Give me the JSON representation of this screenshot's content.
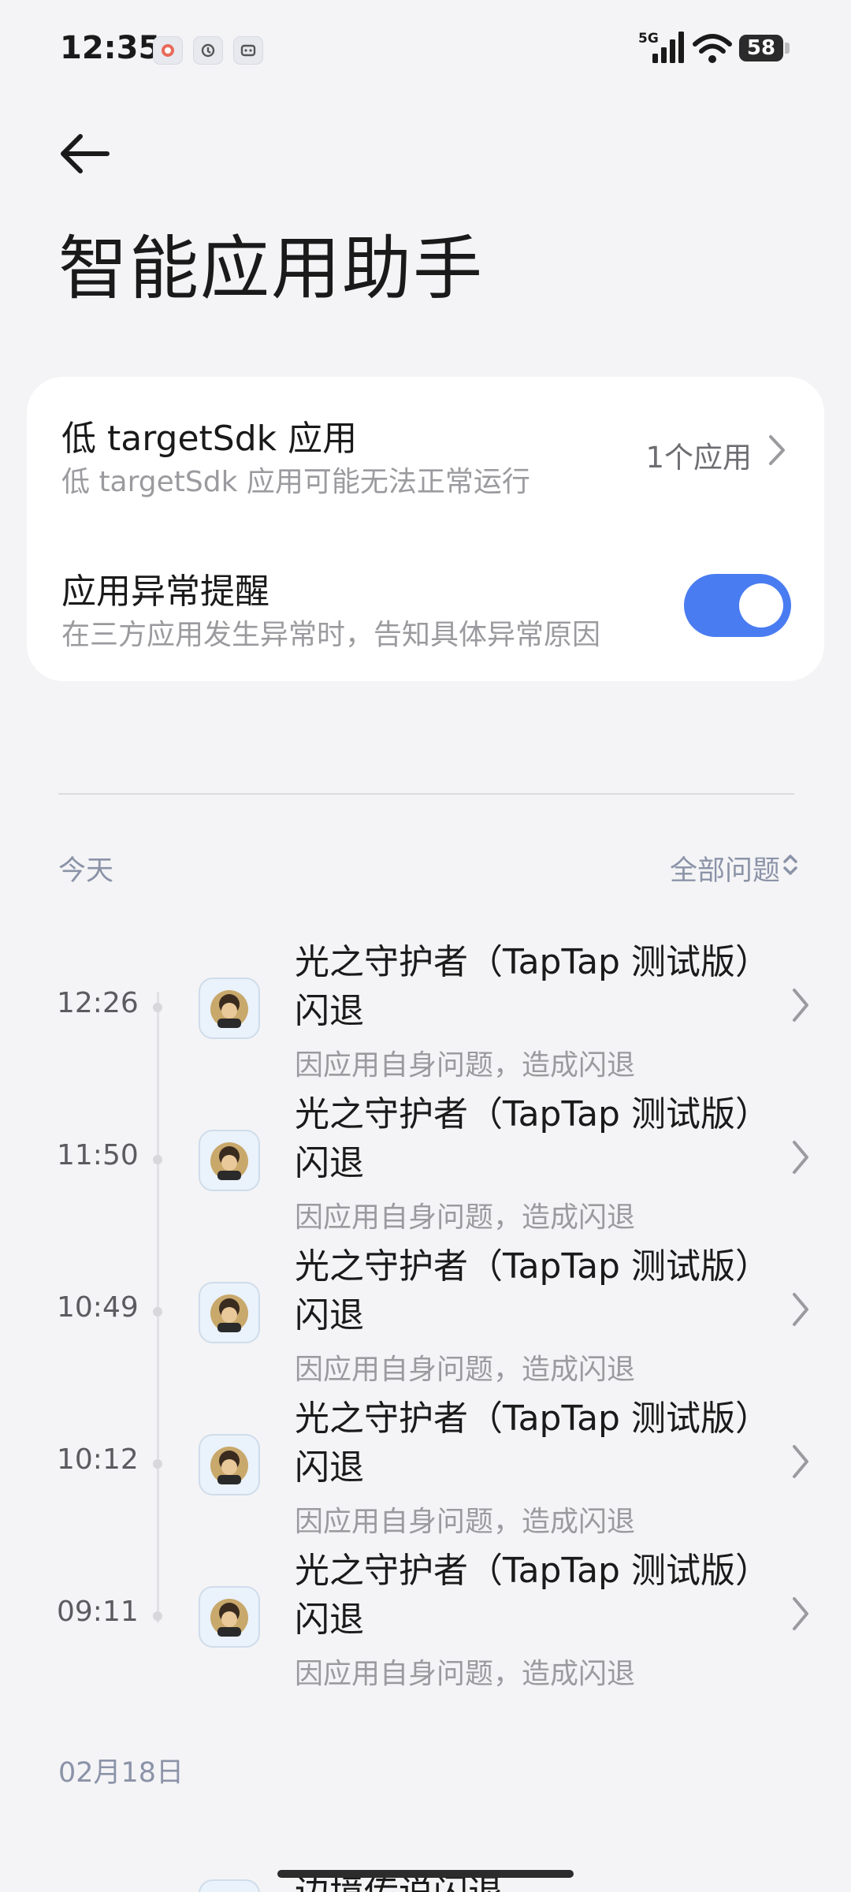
{
  "status_bar": {
    "time": "12:35",
    "network": "5G",
    "battery": "58"
  },
  "header": {
    "title": "智能应用助手"
  },
  "settings": {
    "low_sdk": {
      "title": "低 targetSdk 应用",
      "subtitle": "低 targetSdk 应用可能无法正常运行",
      "value": "1个应用"
    },
    "crash_alert": {
      "title": "应用异常提醒",
      "subtitle": "在三方应用发生异常时，告知具体异常原因",
      "enabled": true
    }
  },
  "filter": {
    "label": "全部问题"
  },
  "groups": [
    {
      "date": "今天",
      "entries": [
        {
          "time": "12:26",
          "app": "光之守护者（TapTap 测试版）闪退",
          "reason": "因应用自身问题，造成闪退"
        },
        {
          "time": "11:50",
          "app": "光之守护者（TapTap 测试版）闪退",
          "reason": "因应用自身问题，造成闪退"
        },
        {
          "time": "10:49",
          "app": "光之守护者（TapTap 测试版）闪退",
          "reason": "因应用自身问题，造成闪退"
        },
        {
          "time": "10:12",
          "app": "光之守护者（TapTap 测试版）闪退",
          "reason": "因应用自身问题，造成闪退"
        },
        {
          "time": "09:11",
          "app": "光之守护者（TapTap 测试版）闪退",
          "reason": "因应用自身问题，造成闪退"
        }
      ]
    },
    {
      "date": "02月18日",
      "entries": [
        {
          "app": "边境传说闪退"
        }
      ]
    }
  ],
  "colors": {
    "accent": "#4a7cf1",
    "background": "#f4f4f6",
    "card": "#ffffff",
    "secondary_text": "#9b9b9f",
    "section_label": "#8b93a8"
  }
}
